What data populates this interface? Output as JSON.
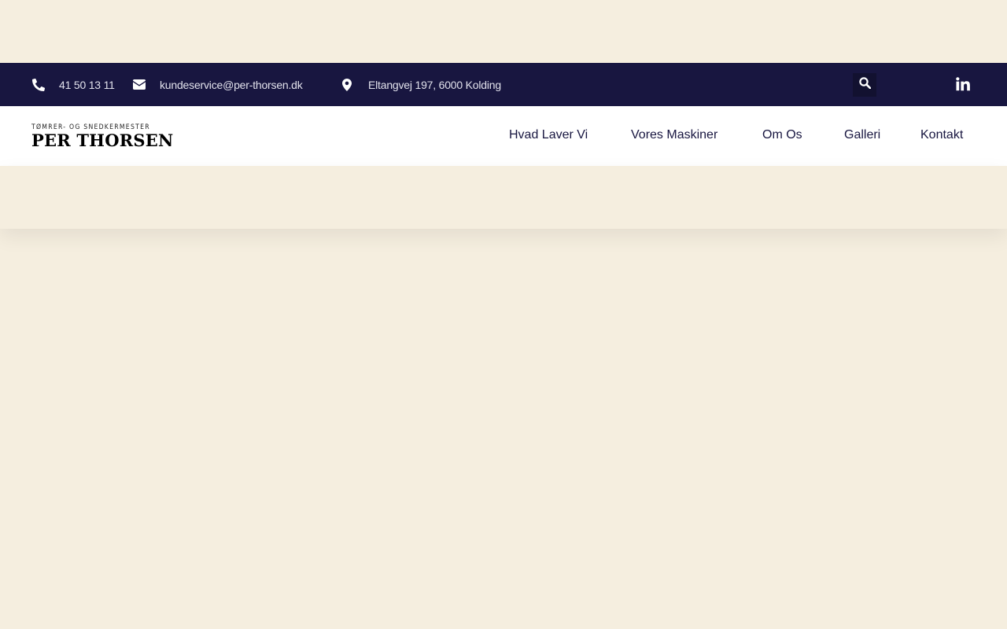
{
  "topbar": {
    "phone": "41 50 13 11",
    "email": "kundeservice@per-thorsen.dk",
    "address": "Eltangvej 197, 6000 Kolding",
    "icons": {
      "phone": "phone-icon",
      "email": "envelope-icon",
      "address": "map-marker-icon",
      "search": "search-icon",
      "social": "linkedin-icon"
    }
  },
  "header": {
    "logo": {
      "tagline": "TØMRER- OG SNEDKERMESTER",
      "name": "PER THORSEN"
    },
    "nav": [
      {
        "label": "Hvad Laver Vi"
      },
      {
        "label": "Vores Maskiner"
      },
      {
        "label": "Om Os"
      },
      {
        "label": "Galleri"
      },
      {
        "label": "Kontakt"
      }
    ]
  },
  "colors": {
    "background": "#f5eedf",
    "topbar": "#181640",
    "header": "#ffffff",
    "nav_text": "#181640"
  }
}
